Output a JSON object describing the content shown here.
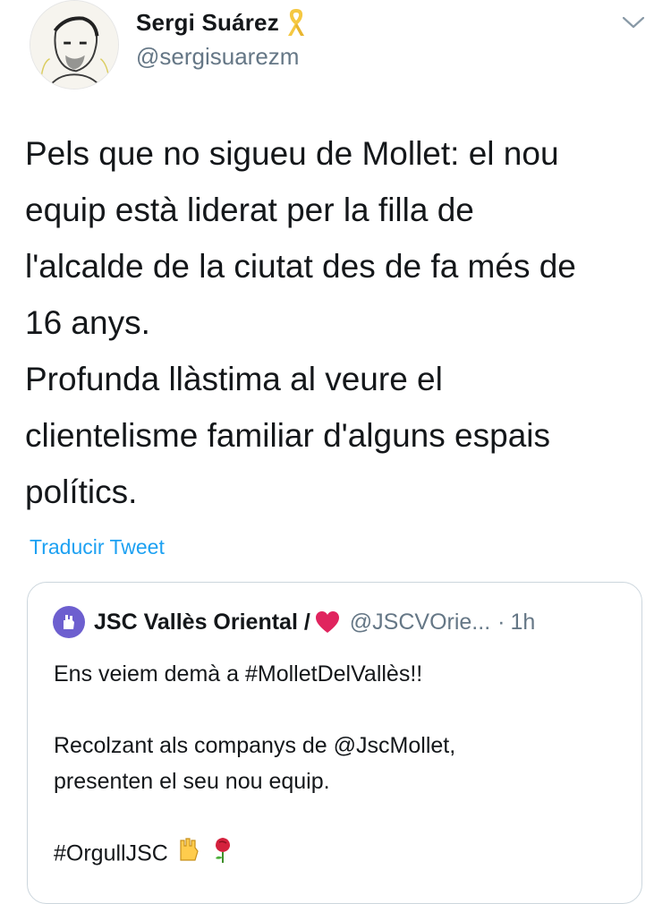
{
  "author": {
    "display_name": "Sergi Suárez",
    "handle": "@sergisuarezm",
    "avatar_icon": "sketch-portrait-avatar",
    "badge_icon": "yellow-ribbon-icon"
  },
  "menu_icon": "chevron-down-icon",
  "tweet": {
    "text": "Pels que no sigueu de Mollet: el nou\nequip està liderat per la filla de\nl'alcalde de la ciutat des de fa més de\n16 anys.\nProfunda llàstima al veure el\nclientelisme familiar d'alguns espais\npolítics.",
    "translate_label": "Traducir Tweet"
  },
  "quote": {
    "display_name": "JSC Vallès Oriental /",
    "handle": "@JSCVOrie...",
    "separator": "·",
    "time": "1h",
    "lines": {
      "line1": "Ens veiem demà a #MolletDelVallès!!",
      "line2": "Recolzant als companys de @JscMollet,",
      "line3": "presenten el seu nou equip.",
      "line4": "#OrgullJSC"
    },
    "emojis": [
      "raised-fist-emoji",
      "rose-emoji"
    ]
  },
  "colors": {
    "text": "#14171a",
    "secondary": "#657786",
    "link": "#1da1f2",
    "border": "#ccd6dd",
    "ribbon": "#f5c842",
    "heart": "#e0245e",
    "jsc_purple": "#6d5fcf"
  }
}
